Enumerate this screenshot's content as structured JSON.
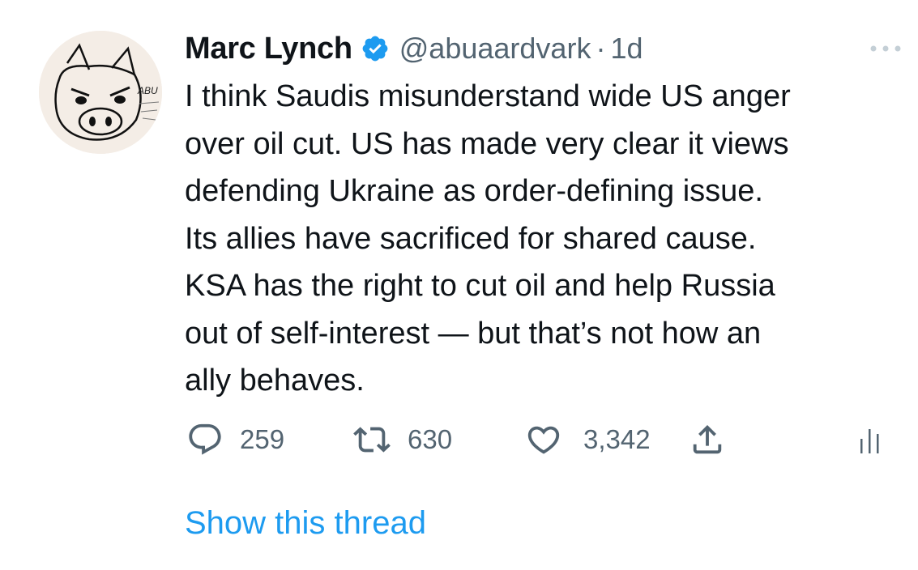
{
  "tweet": {
    "author_name": "Marc Lynch",
    "handle": "@abuaardvark",
    "separator": "·",
    "time": "1d",
    "verified_icon": "verified-badge-icon",
    "text_lines": [
      "I think Saudis misunderstand wide US anger",
      "over oil cut. US has made very clear it views",
      "defending Ukraine as order-defining issue.",
      "Its allies have sacrificed for shared cause.",
      "KSA has the right to cut oil and help Russia",
      "out of self-interest — but that’s not how an",
      "ally behaves."
    ],
    "avatar": {
      "caption": "ABU"
    }
  },
  "actions": {
    "reply": {
      "icon": "reply-icon",
      "count": "259"
    },
    "retweet": {
      "icon": "retweet-icon",
      "count": "630"
    },
    "like": {
      "icon": "heart-icon",
      "count": "3,342"
    },
    "share": {
      "icon": "share-icon"
    },
    "analytics": {
      "icon": "analytics-icon"
    },
    "more": {
      "icon": "more-dots-icon"
    }
  },
  "show_thread": "Show this thread",
  "colors": {
    "text": "#0f1419",
    "secondary": "#536471",
    "accent": "#1d9bf0"
  }
}
